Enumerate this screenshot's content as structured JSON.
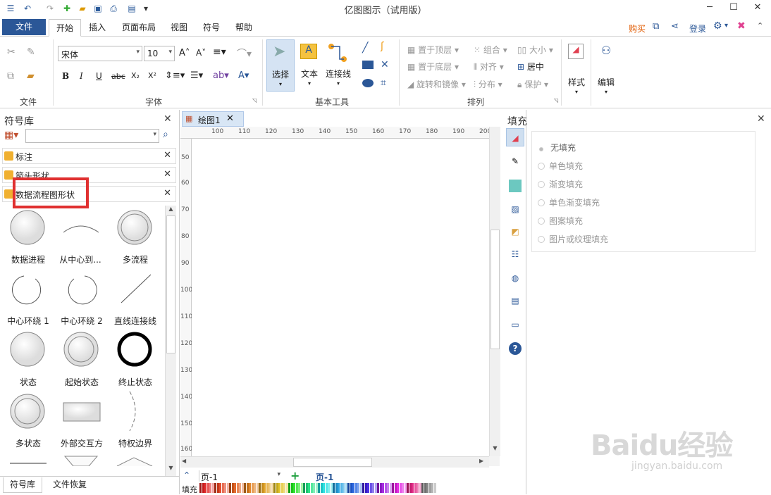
{
  "window": {
    "title": "亿图图示（试用版）"
  },
  "menu": {
    "file": "文件",
    "tabs": [
      "开始",
      "插入",
      "页面布局",
      "视图",
      "符号",
      "帮助"
    ],
    "buy": "购买",
    "login": "登录"
  },
  "ribbon": {
    "font_name": "宋体",
    "font_size": "10",
    "groups": {
      "file": "文件",
      "font": "字体",
      "basic_tools": "基本工具",
      "arrange": "排列"
    },
    "tools": {
      "select": "选择",
      "text": "文本",
      "connector": "连接线"
    },
    "arrange": {
      "top": "置于顶层",
      "bottom": "置于底层",
      "rotate": "旋转和镜像",
      "group": "组合",
      "align": "对齐",
      "distribute": "分布",
      "size": "大小",
      "center": "居中",
      "protect": "保护"
    },
    "style": "样式",
    "edit": "编辑"
  },
  "library": {
    "title": "符号库",
    "search_placeholder": "",
    "categories": [
      "标注",
      "箭头形状",
      "数据流程图形状"
    ],
    "shapes": [
      "数据进程",
      "从中心到...",
      "多流程",
      "中心环绕 1",
      "中心环绕 2",
      "直线连接线",
      "状态",
      "起始状态",
      "终止状态",
      "多状态",
      "外部交互方",
      "特权边界"
    ],
    "bottom_tabs": [
      "符号库",
      "文件恢复"
    ]
  },
  "document": {
    "tab": "绘图1",
    "ruler_h": [
      "100",
      "110",
      "120",
      "130",
      "140",
      "150",
      "160",
      "170",
      "180",
      "190",
      "200"
    ],
    "ruler_v": [
      "50",
      "60",
      "70",
      "80",
      "90",
      "100",
      "110",
      "120",
      "130",
      "140",
      "150",
      "160"
    ],
    "page_select": "页-1",
    "page_tab": "页-1",
    "fill_label": "填充"
  },
  "fill_panel": {
    "title": "填充",
    "options": [
      "无填充",
      "单色填充",
      "渐变填充",
      "单色渐变填充",
      "图案填充",
      "图片或纹理填充"
    ],
    "selected": 0
  },
  "colors": {
    "accent": "#2b5797",
    "highlight": "#e03030"
  },
  "watermark": {
    "brand": "Baidu经验",
    "url": "jingyan.baidu.com"
  }
}
